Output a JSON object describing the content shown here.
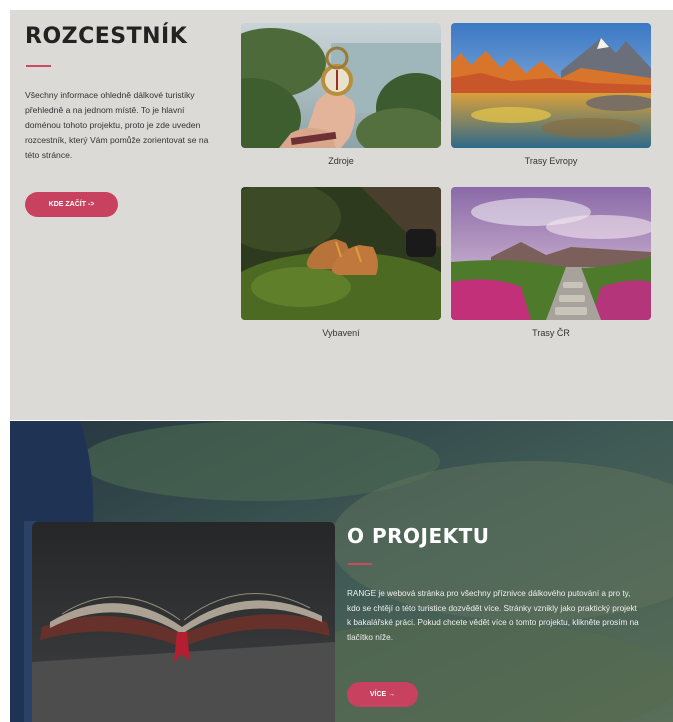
{
  "rozcestnik": {
    "title": "ROZCESTNÍK",
    "description": "Všechny informace ohledně dálkové turistiky přehledně a na jednom místě. To je hlavní doménou tohoto projektu, proto je zde uveden rozcestník, který Vám pomůže zorientovat se na této stránce.",
    "start_button": "KDE ZAČÍT ->",
    "cards": [
      {
        "label": "Zdroje",
        "image": "compass-in-hand"
      },
      {
        "label": "Trasy Evropy",
        "image": "mountain-lake-autumn"
      },
      {
        "label": "Vybavení",
        "image": "hiking-boots-on-moss"
      },
      {
        "label": "Trasy ČR",
        "image": "stone-path-heather"
      }
    ]
  },
  "projekt": {
    "title": "O PROJEKTU",
    "description": "RANGE je webová stránka pro všechny příznivce dálkového putování a pro ty, kdo se chtějí o této turistice dozvědět více. Stránky vznikly jako praktický projekt k bakalářské práci. Pokud chcete vědět více o tomto projektu, klikněte prosím na tlačítko níže.",
    "more_button": "VÍCE →",
    "image": "open-book"
  },
  "colors": {
    "accent": "#c8415f",
    "section_bg": "#dcdad7",
    "title_text": "#222222"
  }
}
